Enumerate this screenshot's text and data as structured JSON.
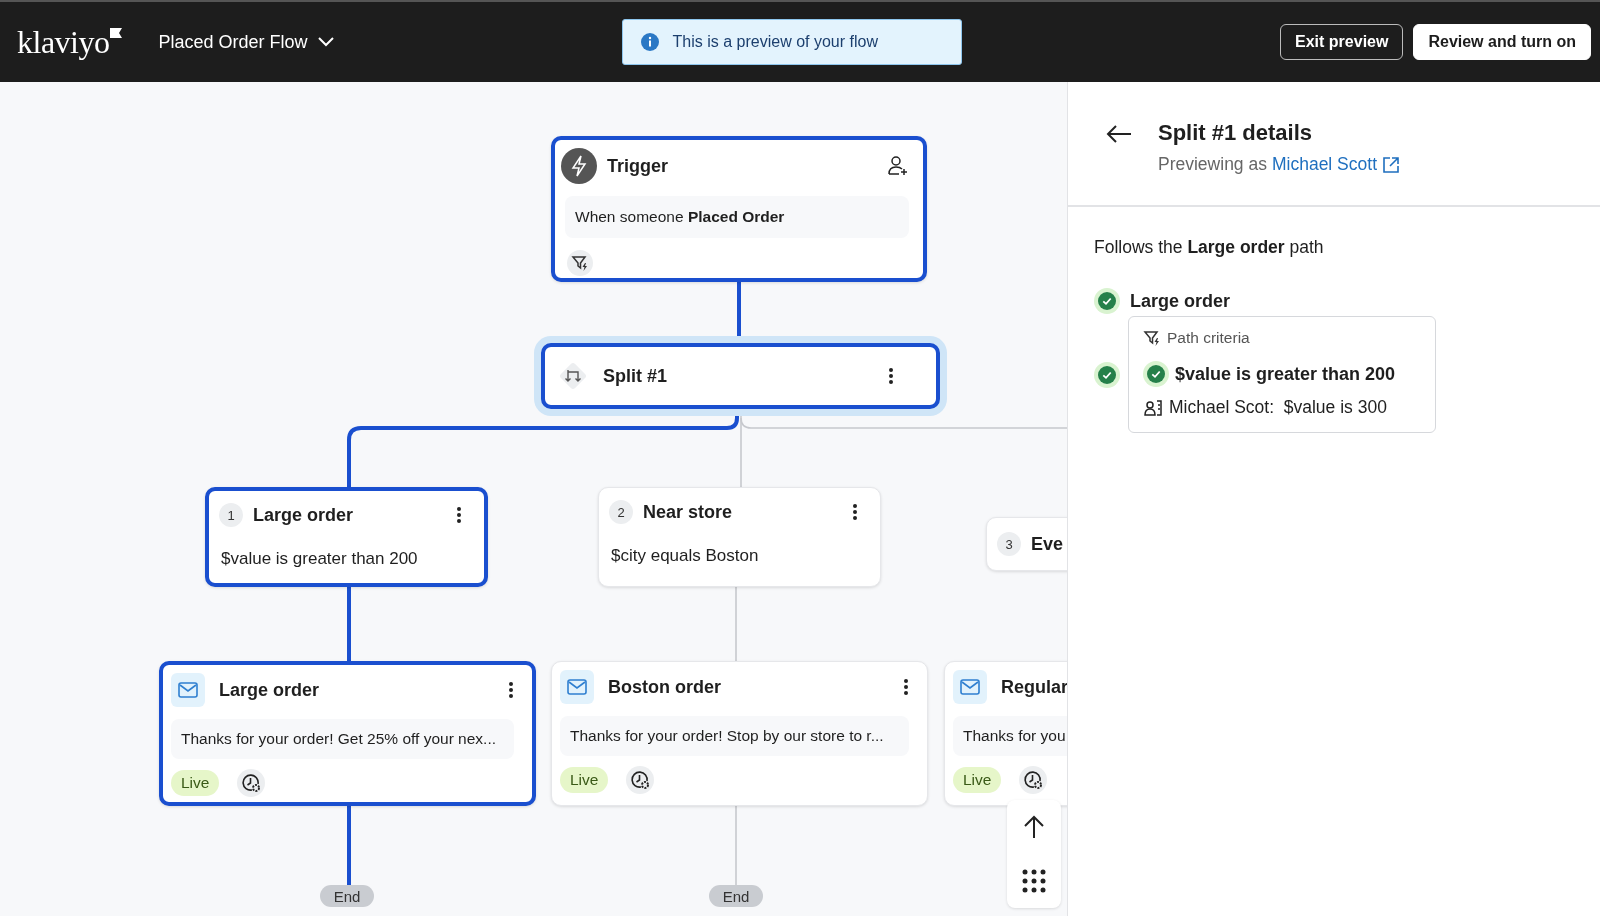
{
  "header": {
    "logo": "klaviyo",
    "flow_name": "Placed Order Flow",
    "banner": "This is a preview of your flow",
    "buttons": [
      {
        "label": "Exit preview",
        "kind": "outline"
      },
      {
        "label": "Review and turn on",
        "kind": "primary"
      }
    ]
  },
  "canvas": {
    "trigger": {
      "title": "Trigger",
      "description": "When someone **Placed Order**",
      "selected": true
    },
    "split": {
      "title": "Split #1",
      "selected": true
    },
    "paths": [
      {
        "number": "1",
        "title": "Large order",
        "criteria": "$value is greater than 200",
        "selected": true
      },
      {
        "number": "2",
        "title": "Near store",
        "criteria": "$city equals Boston",
        "selected": false
      },
      {
        "number": "3",
        "title": "Eve",
        "selected": false
      }
    ],
    "emails": [
      {
        "title": "Large order",
        "preview": "Thanks for your order! Get 25% off your nex...",
        "status": "Live",
        "selected": true
      },
      {
        "title": "Boston order",
        "preview": "Thanks for your order! Stop by our store to r...",
        "status": "Live",
        "selected": false
      },
      {
        "title": "Regular",
        "preview": "Thanks for you",
        "status": "Live",
        "selected": false
      }
    ],
    "ends": [
      "End",
      "End"
    ]
  },
  "panel": {
    "title": "Split #1 details",
    "previewing_label": "Previewing as",
    "profile_link": "Michael Scott",
    "summary": "Follows the **Large order** path",
    "path": {
      "name": "Large order",
      "passed": true
    },
    "criteria": {
      "heading": "Path criteria",
      "condition": "$value is greater than 200",
      "passed": true,
      "profile_value": "Michael Scot:  $value is 300"
    }
  }
}
